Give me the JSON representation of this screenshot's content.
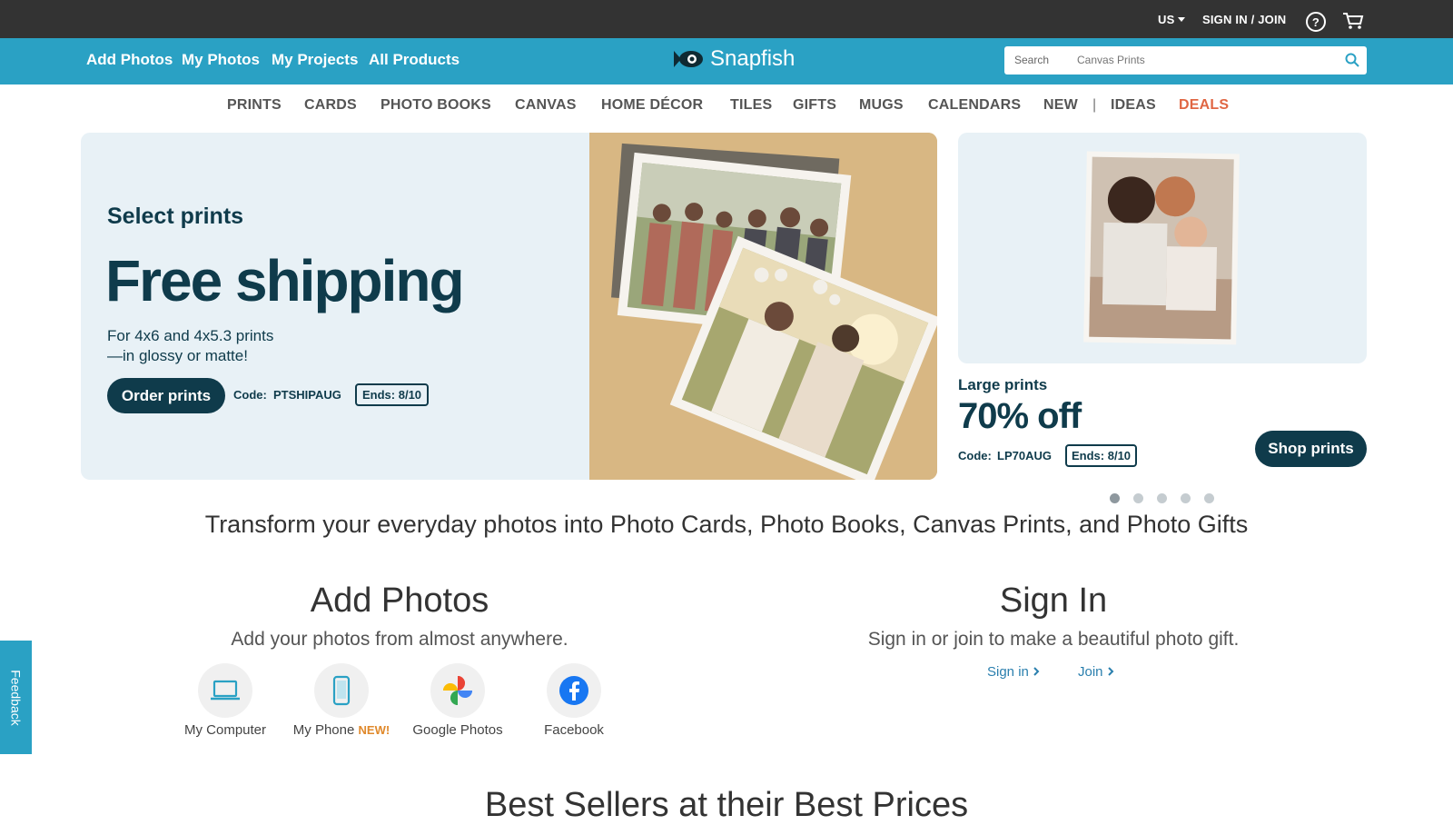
{
  "utility": {
    "country": "US",
    "signin": "SIGN IN / JOIN",
    "help": "?"
  },
  "nav": {
    "links": [
      "Add Photos",
      "My Photos",
      "My Projects",
      "All Products"
    ],
    "logo_text": "Snapfish",
    "search_label": "Search",
    "search_placeholder": "Canvas Prints"
  },
  "categories": [
    "PRINTS",
    "CARDS",
    "PHOTO BOOKS",
    "CANVAS",
    "HOME DÉCOR",
    "TILES",
    "GIFTS",
    "MUGS",
    "CALENDARS",
    "NEW",
    "IDEAS",
    "DEALS"
  ],
  "category_separator": "|",
  "hero": {
    "kicker": "Select prints",
    "title": "Free shipping",
    "subtitle_line1": "For 4x6 and 4x5.3 prints",
    "subtitle_line2": "—in glossy or matte!",
    "button": "Order prints",
    "code_label": "Code:",
    "code": "PTSHIPAUG",
    "ends": "Ends: 8/10"
  },
  "promo": {
    "kicker": "Large prints",
    "title": "70% off",
    "code_label": "Code:",
    "code": "LP70AUG",
    "ends": "Ends: 8/10",
    "button": "Shop prints"
  },
  "carousel": {
    "count": 5,
    "active_index": 0
  },
  "tagline": "Transform your everyday photos into Photo Cards, Photo Books, Canvas Prints, and Photo Gifts",
  "add_photos": {
    "title": "Add Photos",
    "subtitle": "Add your photos from almost anywhere.",
    "sources": [
      {
        "label": "My Computer",
        "icon": "laptop-icon",
        "badge": ""
      },
      {
        "label": "My Phone",
        "icon": "phone-icon",
        "badge": "NEW!"
      },
      {
        "label": "Google Photos",
        "icon": "google-photos-icon",
        "badge": ""
      },
      {
        "label": "Facebook",
        "icon": "facebook-icon",
        "badge": ""
      }
    ]
  },
  "sign_in": {
    "title": "Sign In",
    "subtitle": "Sign in or join to make a beautiful photo gift.",
    "signin_link": "Sign in",
    "join_link": "Join"
  },
  "feedback": "Feedback",
  "best_sellers": "Best Sellers at their Best Prices",
  "colors": {
    "utility_bg": "#333333",
    "nav_bg": "#2aa1c4",
    "brand_dark": "#0f3b4b",
    "deals": "#e06643",
    "new_badge": "#e0892b"
  }
}
